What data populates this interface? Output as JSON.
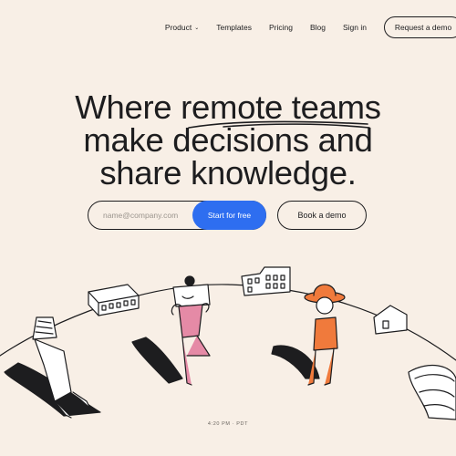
{
  "nav": {
    "items": [
      {
        "label": "Product",
        "has_dropdown": true
      },
      {
        "label": "Templates"
      },
      {
        "label": "Pricing"
      },
      {
        "label": "Blog"
      },
      {
        "label": "Sign in"
      }
    ],
    "demo_button": "Request a demo"
  },
  "hero": {
    "line1": "Where remote teams",
    "line2": "make decisions and",
    "line3": "share knowledge."
  },
  "signup": {
    "email_placeholder": "name@company.com",
    "start_button": "Start for free",
    "book_button": "Book a demo"
  },
  "footer": {
    "clock": "4:20 PM · PDT"
  },
  "colors": {
    "background": "#f8efe6",
    "primary": "#2e6ef0",
    "text": "#1d1d1f",
    "accent_orange": "#f07a3c",
    "accent_pink": "#e58aa6"
  }
}
